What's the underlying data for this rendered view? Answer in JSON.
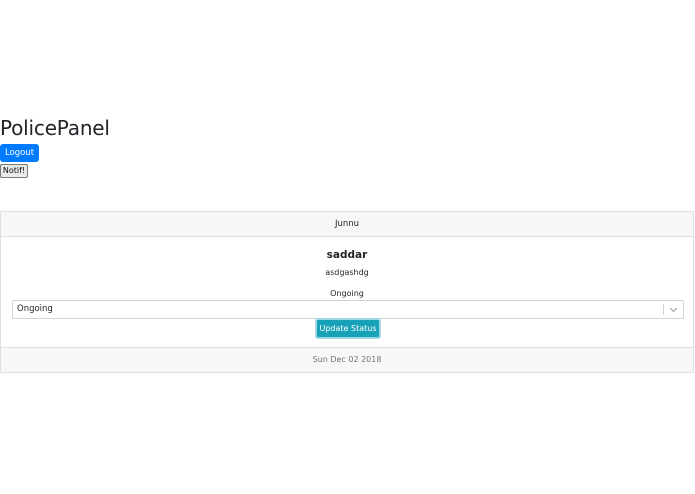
{
  "header": {
    "title": "PolicePanel",
    "logout_label": "Logout",
    "notif_label": "Notif!"
  },
  "card": {
    "header": "Junnu",
    "title": "saddar",
    "text": "asdgashdg",
    "status": "Ongoing",
    "status_select": {
      "selected": "Ongoing"
    },
    "update_label": "Update Status",
    "footer": "Sun Dec 02 2018"
  },
  "colors": {
    "primary": "#007bff",
    "info": "#17a2b8",
    "muted": "#6c757d"
  },
  "icons": {
    "select_arrow": "chevron-down-icon"
  }
}
